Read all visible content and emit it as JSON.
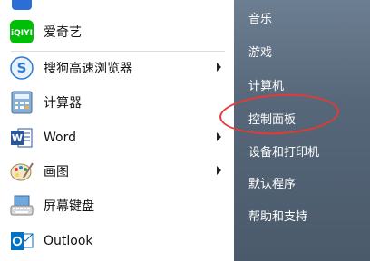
{
  "left_menu": {
    "items": [
      {
        "label": "",
        "icon": "app-icon"
      },
      {
        "label": "爱奇艺",
        "icon": "iqiyi-icon"
      },
      {
        "label": "搜狗高速浏览器",
        "icon": "sogou-browser-icon",
        "submenu": true
      },
      {
        "label": "计算器",
        "icon": "calculator-icon"
      },
      {
        "label": "Word",
        "icon": "word-icon",
        "submenu": true
      },
      {
        "label": "画图",
        "icon": "paint-icon",
        "submenu": true
      },
      {
        "label": "屏幕键盘",
        "icon": "keyboard-icon"
      },
      {
        "label": "Outlook",
        "icon": "outlook-icon"
      }
    ]
  },
  "right_menu": {
    "items": [
      "音乐",
      "游戏",
      "计算机",
      "控制面板",
      "设备和打印机",
      "默认程序",
      "帮助和支持"
    ]
  },
  "colors": {
    "highlight_ellipse": "#e53935",
    "right_panel": "#566779"
  }
}
